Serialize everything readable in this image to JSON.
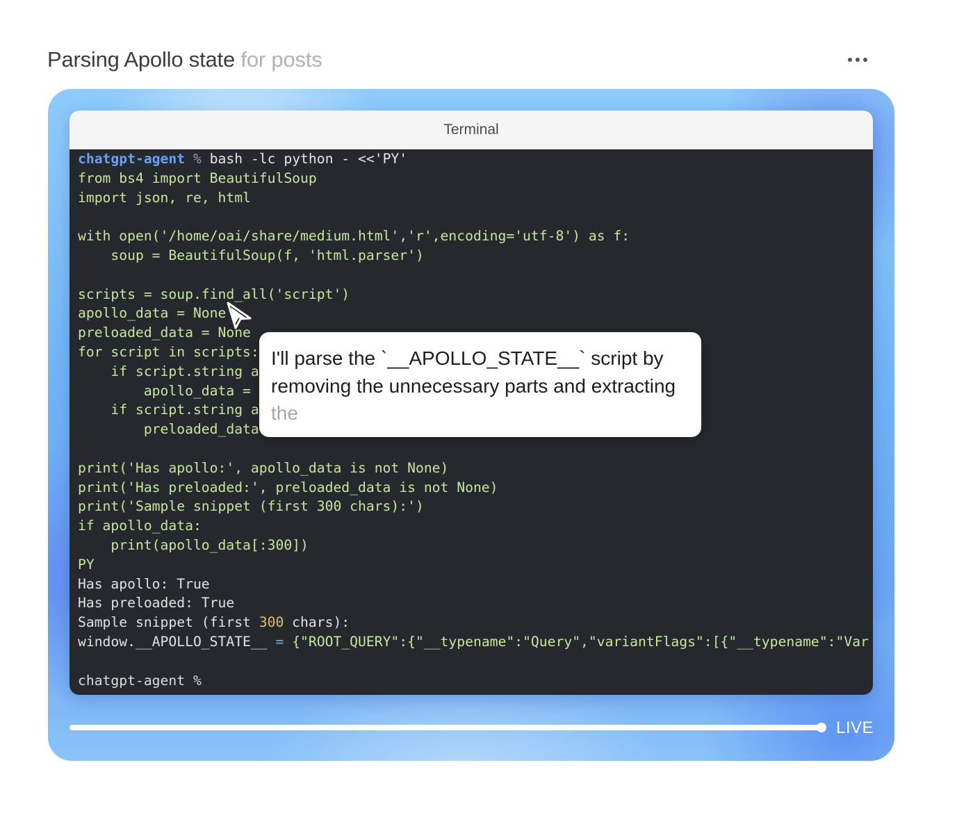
{
  "header": {
    "title_main": "Parsing Apollo state",
    "title_fade": " for posts",
    "more_icon": "more-horizontal-icon"
  },
  "terminal": {
    "window_title": "Terminal",
    "prompt": "chatgpt-agent",
    "prompt_symbol": "%",
    "command": " bash -lc python - <<'PY'",
    "script_lines": [
      "from bs4 import BeautifulSoup",
      "import json, re, html",
      "",
      "with open('/home/oai/share/medium.html','r',encoding='utf-8') as f:",
      "    soup = BeautifulSoup(f, 'html.parser')",
      "",
      "scripts = soup.find_all('script')",
      "apollo_data = None",
      "preloaded_data = None",
      "for script in scripts:",
      "    if script.string a",
      "        apollo_data = ",
      "    if script.string a",
      "        preloaded_data",
      "",
      "print('Has apollo:', apollo_data is not None)",
      "print('Has preloaded:', preloaded_data is not None)",
      "print('Sample snippet (first 300 chars):')",
      "if apollo_data:",
      "    print(apollo_data[:300])",
      "PY"
    ],
    "output": {
      "line1": "Has apollo: True",
      "line2": "Has preloaded: True",
      "line3_pre": "Sample snippet (first ",
      "line3_num": "300",
      "line3_post": " chars):",
      "line4_var": "window.__APOLLO_STATE__ ",
      "line4_eq": "=",
      "line4_json": " {\"ROOT_QUERY\":{\"__typename\":\"Query\",\"variantFlags\":[{\"__typename\":\"Var"
    },
    "final_prompt": "chatgpt-agent %"
  },
  "narration": {
    "text": "I'll parse the `__APOLLO_STATE__` script by removing the unnecessary parts and extracting",
    "text_fade": " the"
  },
  "cursor_icon": "mouse-pointer-icon",
  "progress": {
    "value": 1.0
  },
  "live_label": "LIVE"
}
